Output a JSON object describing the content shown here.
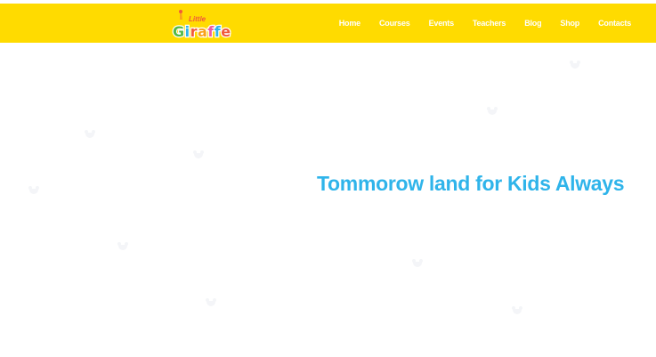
{
  "header": {
    "background_color": "#ffdb00",
    "logo": {
      "line1": "Little",
      "line2": "Giraffe",
      "letter_colors": [
        "#54b948",
        "#2fb4ea",
        "#f15a3a",
        "#f9a21b",
        "#ef5ba1",
        "#2fb4ea",
        "#f15a3a"
      ]
    },
    "nav": [
      {
        "label": "Home"
      },
      {
        "label": "Courses"
      },
      {
        "label": "Events"
      },
      {
        "label": "Teachers"
      },
      {
        "label": "Blog"
      },
      {
        "label": "Shop"
      },
      {
        "label": "Contacts"
      }
    ]
  },
  "hero": {
    "title": "Tommorow land for Kids Always",
    "title_color": "#2fb4ea"
  }
}
